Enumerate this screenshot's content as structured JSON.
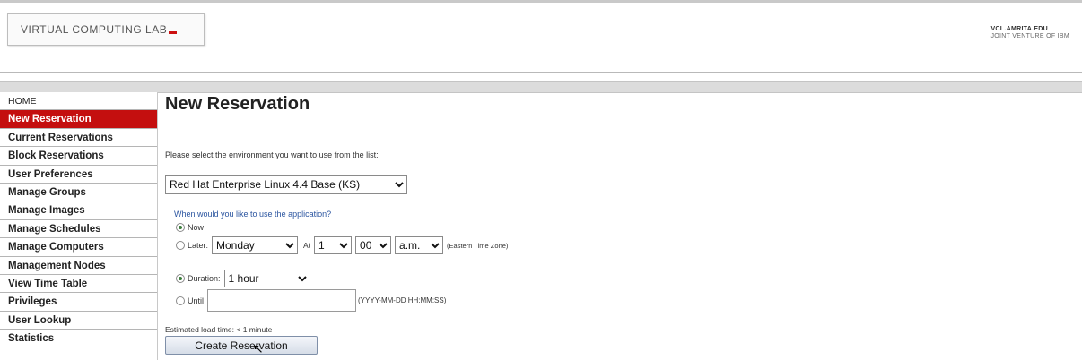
{
  "header": {
    "logo_text": "VIRTUAL COMPUTING LAB",
    "brand_line1": "VCL.AMRITA.EDU",
    "brand_line2": "JOINT VENTURE OF IBM"
  },
  "sidebar": {
    "items": [
      {
        "label": "HOME"
      },
      {
        "label": "New Reservation"
      },
      {
        "label": "Current Reservations"
      },
      {
        "label": "Block Reservations"
      },
      {
        "label": "User Preferences"
      },
      {
        "label": "Manage Groups"
      },
      {
        "label": "Manage Images"
      },
      {
        "label": "Manage Schedules"
      },
      {
        "label": "Manage Computers"
      },
      {
        "label": "Management Nodes"
      },
      {
        "label": "View Time Table"
      },
      {
        "label": "Privileges"
      },
      {
        "label": "User Lookup"
      },
      {
        "label": "Statistics"
      }
    ],
    "active_index": 1
  },
  "main": {
    "title": "New Reservation",
    "prompt": "Please select the environment you want to use from the list:",
    "environment": "Red Hat Enterprise Linux 4.4 Base (KS)",
    "when_label": "When would you like to use the application?",
    "now_label": "Now",
    "later_label": "Later:",
    "day": "Monday",
    "at_label": "At",
    "hour": "1",
    "minute": "00",
    "ampm": "a.m.",
    "timezone": "(Eastern Time Zone)",
    "duration_label": "Duration:",
    "duration": "1 hour",
    "until_label": "Until",
    "until_value": "",
    "until_format": "(YYYY-MM-DD HH:MM:SS)",
    "estimated": "Estimated load time: < 1 minute",
    "create_button": "Create Reservation"
  },
  "colors": {
    "active_nav": "#c40f0f",
    "link_blue": "#2b55a0",
    "radio_selected": "#3a7d3a"
  }
}
